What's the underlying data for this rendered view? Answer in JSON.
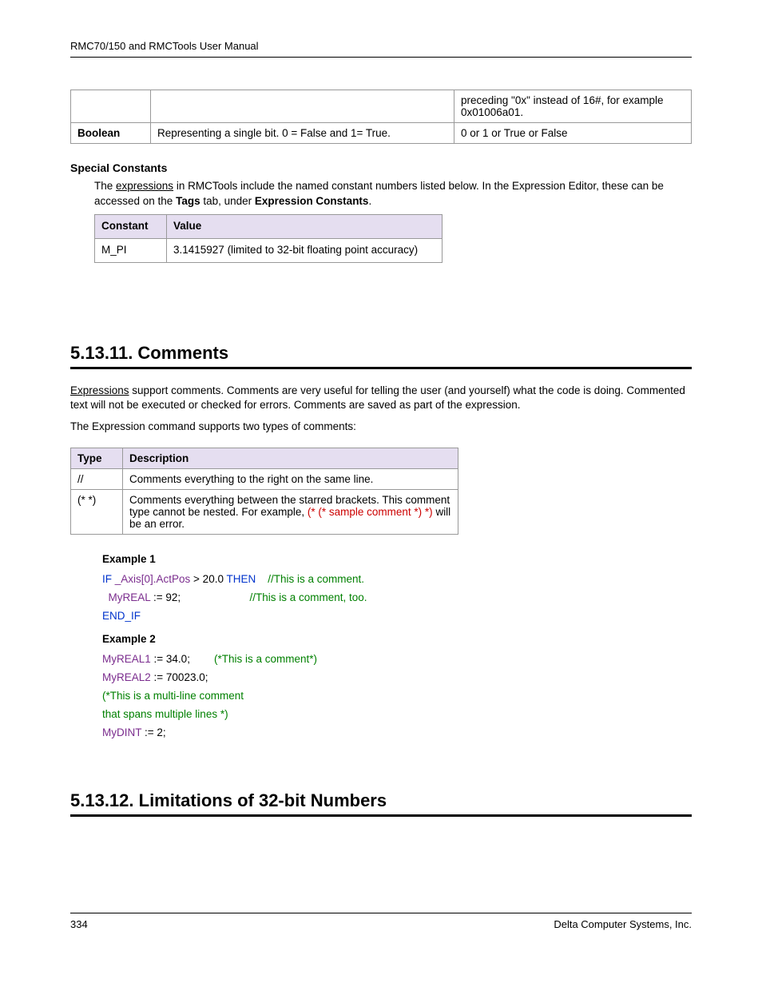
{
  "header": {
    "title": "RMC70/150 and RMCTools User Manual"
  },
  "top_table": {
    "row0": {
      "c2_text": "preceding \"0x\" instead of 16#, for example 0x01006a01."
    },
    "row1": {
      "c0": "Boolean",
      "c1": "Representing a single bit. 0 = False and 1= True.",
      "c2": "0 or 1 or True or False"
    }
  },
  "special_constants": {
    "heading": "Special Constants",
    "intro_a": "The ",
    "intro_link": "expressions",
    "intro_b": " in RMCTools include the named constant numbers listed below. In the Expression Editor, these can be accessed on the ",
    "tags": "Tags",
    "intro_c": " tab, under ",
    "exprconst": "Expression Constants",
    "intro_d": ".",
    "th0": "Constant",
    "th1": "Value",
    "r0c0": "M_PI",
    "r0c1": "3.1415927 (limited to 32-bit floating point accuracy)"
  },
  "comments_section": {
    "heading": "5.13.11. Comments",
    "p1_link": "Expressions",
    "p1_rest": " support comments. Comments are very useful for telling the user (and yourself) what the code is doing. Commented text will not be executed or checked for errors. Comments are saved as part of the expression.",
    "p2": "The Expression command supports two types of comments:",
    "th0": "Type",
    "th1": "Description",
    "r0c0": "//",
    "r0c1": "Comments everything to the right on the same line.",
    "r1c0": "(* *)",
    "r1c1a": "Comments everything between the starred brackets. This comment type cannot be nested. For example, ",
    "r1c1b": "(* (* sample comment *) *)",
    "r1c1c": " will be an error."
  },
  "examples": {
    "ex1_label": "Example 1",
    "ex1_l1_kw1": "IF",
    "ex1_l1_id": " _Axis[0].ActPos",
    "ex1_l1_mid": " > 20.0 ",
    "ex1_l1_kw2": "THEN",
    "ex1_l1_sp": "    ",
    "ex1_l1_cm": "//This is a comment.",
    "ex1_l2_indent": "  ",
    "ex1_l2_id": "MyREAL",
    "ex1_l2_rest": " := 92;",
    "ex1_l2_sp": "                       ",
    "ex1_l2_cm": "//This is a comment, too.",
    "ex1_l3_kw": "END_IF",
    "ex2_label": "Example 2",
    "ex2_l1_id": "MyREAL1",
    "ex2_l1_rest": " := 34.0;",
    "ex2_l1_sp": "        ",
    "ex2_l1_cm": "(*This is a comment*)",
    "ex2_l2_id": "MyREAL2",
    "ex2_l2_rest": " := 70023.0;",
    "ex2_l3_cm": "(*This is a multi-line comment",
    "ex2_l4_cm": "that spans multiple lines *)",
    "ex2_l5_id": "MyDINT",
    "ex2_l5_rest": " := 2;"
  },
  "limitations": {
    "heading": "5.13.12. Limitations of 32-bit Numbers"
  },
  "footer": {
    "page": "334",
    "company": "Delta Computer Systems, Inc."
  }
}
